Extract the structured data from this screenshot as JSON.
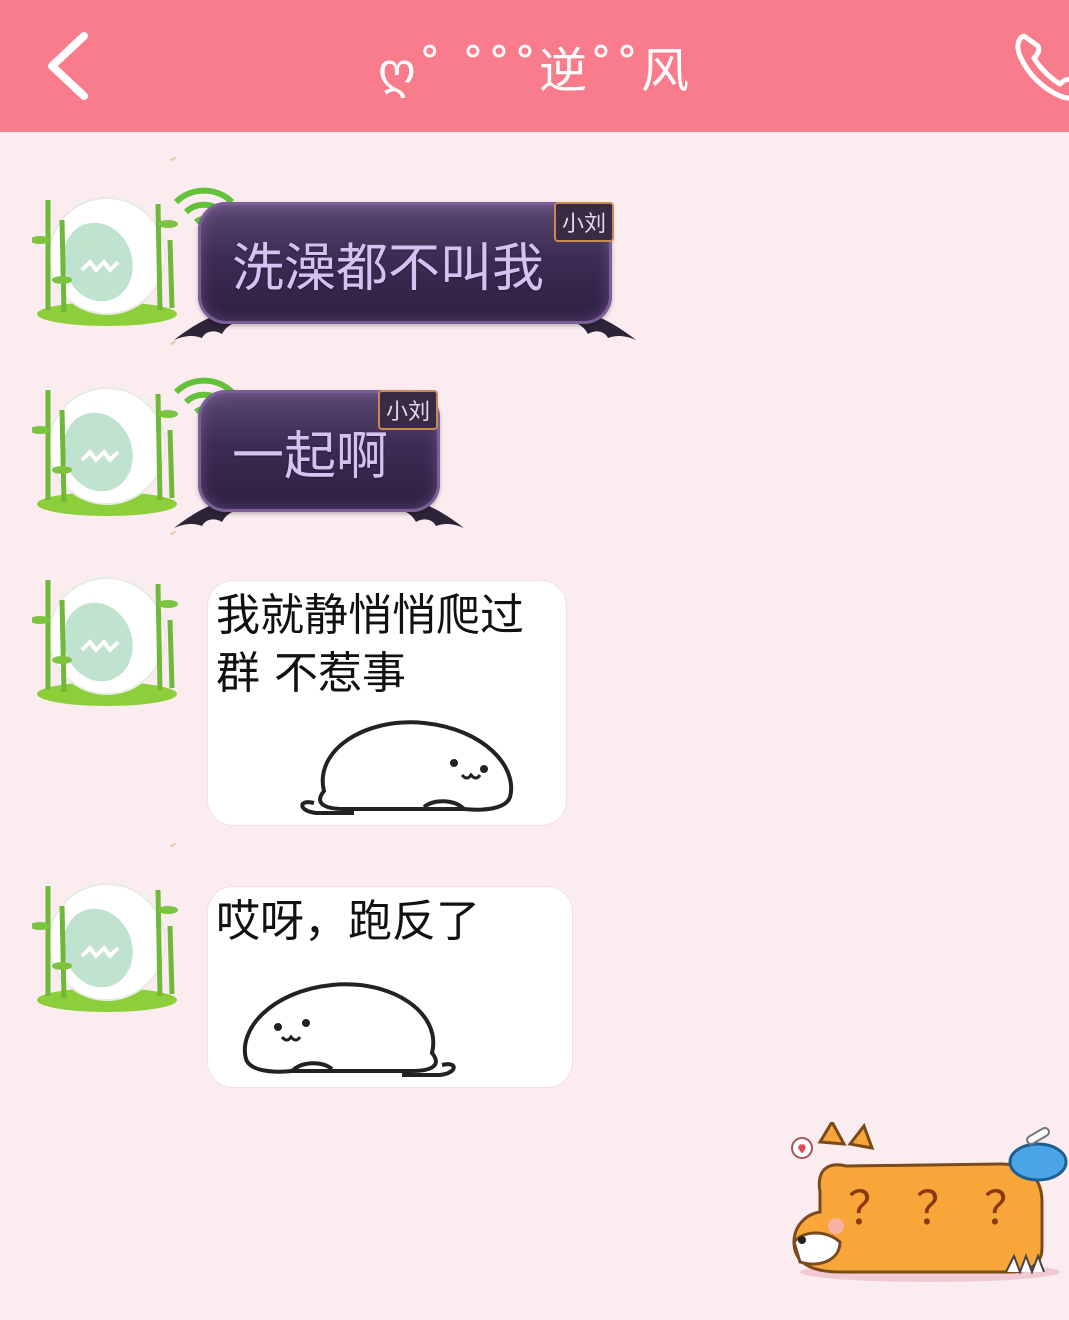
{
  "header": {
    "title": "ღ˚ ˚˚˚逆˚˚风",
    "background_color": "#f97c8c",
    "back_icon": "chevron-left-icon",
    "call_icon": "phone-icon"
  },
  "messages": [
    {
      "type": "bubble",
      "text": "洗澡都不叫我",
      "name_tag": "小刘"
    },
    {
      "type": "bubble",
      "text": "一起啊",
      "name_tag": "小刘"
    },
    {
      "type": "sticker",
      "caption": "我就静悄悄爬过\n群  不惹事",
      "image": "white-seal-crawling-right"
    },
    {
      "type": "sticker",
      "caption": "哎呀，跑反了",
      "image": "white-seal-crawling-left"
    },
    {
      "type": "sticker",
      "caption": "？？？",
      "image": "corgi-sticker",
      "side": "right"
    }
  ],
  "colors": {
    "chat_background": "#fbecf0",
    "bubble_text": "#d3c2f2",
    "bubble_background": "#3c2d54"
  }
}
